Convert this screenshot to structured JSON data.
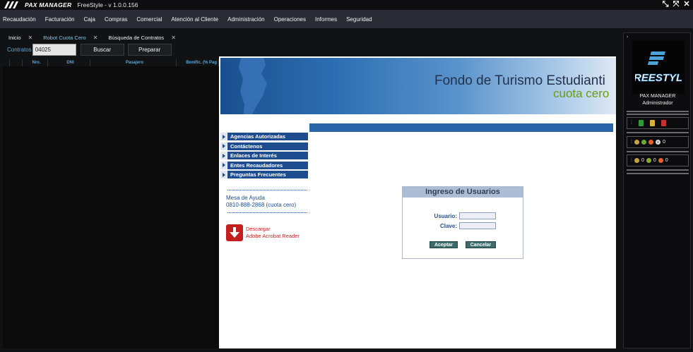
{
  "window": {
    "logo_text": "PAX MANAGER",
    "title": "FreeStyle - v 1.0.0.156",
    "controls": [
      "minimize-icon",
      "restore-icon",
      "close-icon"
    ]
  },
  "menu": [
    "Recaudación",
    "Facturación",
    "Caja",
    "Compras",
    "Comercial",
    "Atención al Cliente",
    "Administración",
    "Operaciones",
    "Informes",
    "Seguridad"
  ],
  "tabs": [
    {
      "label": "Inicio",
      "active": false
    },
    {
      "label": "Robot Cuota Cero",
      "active": true
    },
    {
      "label": "Búsqueda de Contratos",
      "active": false
    }
  ],
  "toolbar": {
    "contratos_label": "Contratos",
    "contratos_value": "04025",
    "buscar": "Buscar",
    "preparar": "Preparar"
  },
  "grid": {
    "columns": [
      "Nro.",
      "DNI",
      "Pasajero",
      "Bonific. (% Pag"
    ]
  },
  "site": {
    "banner_title": "Fondo de Turismo Estudianti",
    "banner_subtitle": "cuota cero",
    "nav": [
      "Agencias Autorizadas",
      "Contáctenos",
      "Enlaces de Interés",
      "Entes Recaudadores",
      "Preguntas Frecuentes"
    ],
    "help_title": "Mesa de Ayuda",
    "help_phone": "0810-888-2868 (cuota cero)",
    "pdf_line1": "Descargar",
    "pdf_line2": "Adobe Acrobat Reader",
    "login": {
      "title": "Ingreso de Usuarios",
      "user_label": "Usuario:",
      "pass_label": "Clave:",
      "accept": "Aceptar",
      "cancel": "Cancelar"
    }
  },
  "right_panel": {
    "arrow": "›",
    "logo_text": "FREESTYLE",
    "user_name": "PAX MANAGER",
    "user_role": "Administrador",
    "box2_count": "0",
    "box3_counts": [
      "0",
      "0",
      "0"
    ]
  },
  "colors": {
    "menubar": "#2a2c35",
    "accent_blue": "#5aa7d6",
    "site_blue": "#1e4d8f",
    "login_head": "#aebdd6",
    "button_teal": "#3d6b6b"
  }
}
